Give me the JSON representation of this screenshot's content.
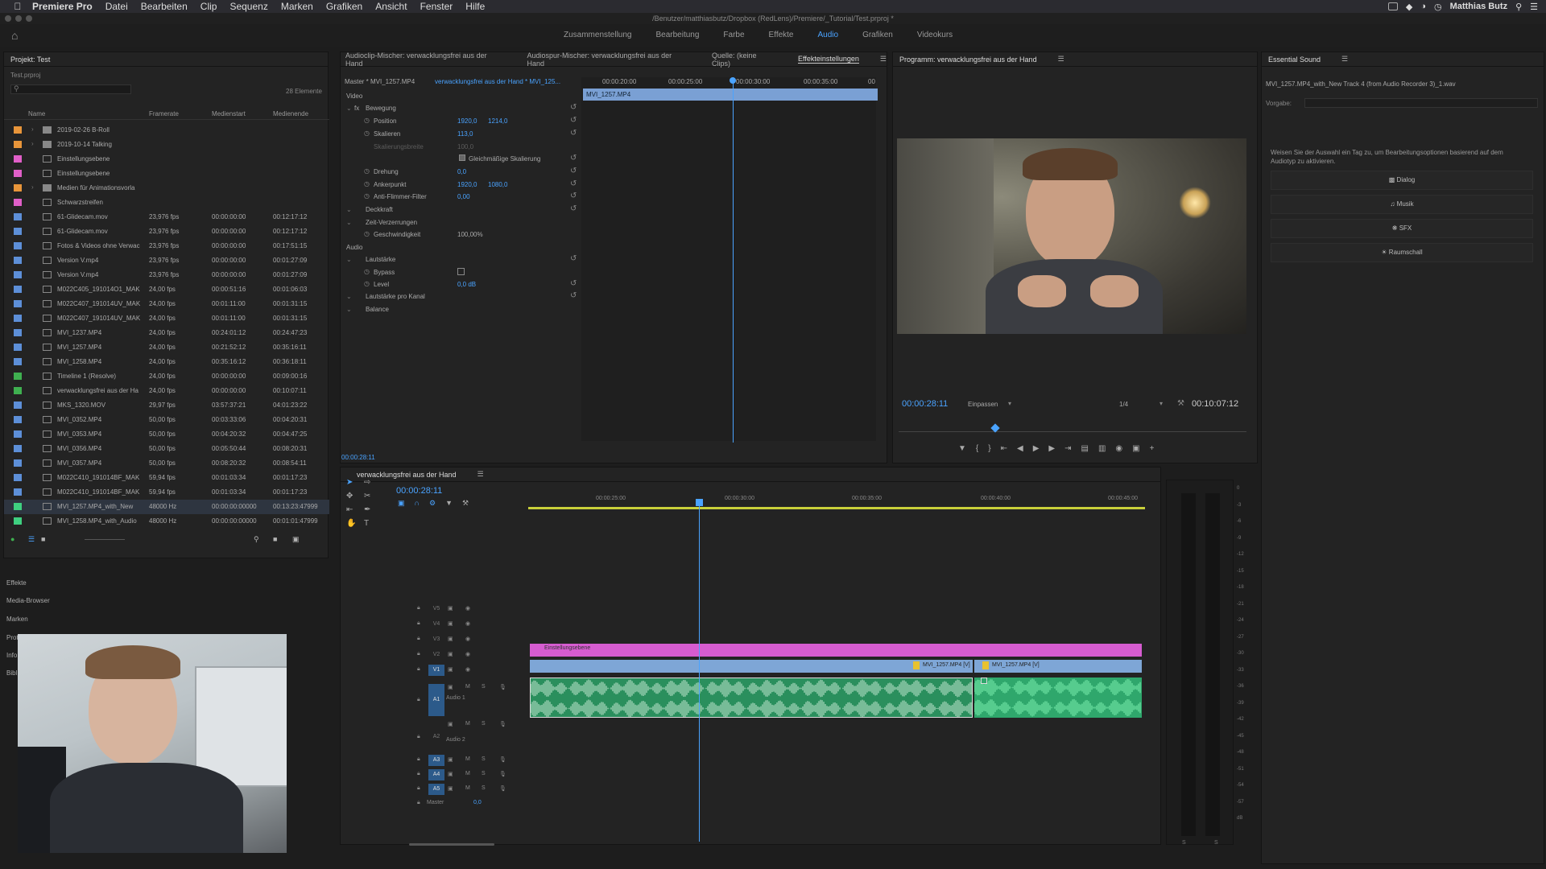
{
  "menubar": {
    "app": "Premiere Pro",
    "items": [
      "Datei",
      "Bearbeiten",
      "Clip",
      "Sequenz",
      "Marken",
      "Grafiken",
      "Ansicht",
      "Fenster",
      "Hilfe"
    ],
    "user": "Matthias Butz"
  },
  "titlebar": {
    "path": "/Benutzer/matthiasbutz/Dropbox (RedLens)/Premiere/_Tutorial/Test.prproj *"
  },
  "workspaces": {
    "tabs": [
      "Zusammenstellung",
      "Bearbeitung",
      "Farbe",
      "Effekte",
      "Audio",
      "Grafiken",
      "Videokurs"
    ],
    "active": "Audio"
  },
  "project": {
    "title": "Projekt: Test",
    "file": "Test.prproj",
    "count": "28 Elemente",
    "columns": {
      "name": "Name",
      "framerate": "Framerate",
      "start": "Medienstart",
      "end": "Medienende"
    },
    "rows": [
      {
        "color": "#e8953a",
        "name": "2019-02-26 B-Roll",
        "fr": "",
        "st": "",
        "en": "",
        "folder": true
      },
      {
        "color": "#e8953a",
        "name": "2019-10-14 Talking",
        "fr": "",
        "st": "",
        "en": "",
        "folder": true
      },
      {
        "color": "#e05fc8",
        "name": "Einstellungsebene",
        "fr": "",
        "st": "",
        "en": ""
      },
      {
        "color": "#e05fc8",
        "name": "Einstellungsebene",
        "fr": "",
        "st": "",
        "en": ""
      },
      {
        "color": "#e8953a",
        "name": "Medien für Animationsvorla",
        "fr": "",
        "st": "",
        "en": "",
        "folder": true
      },
      {
        "color": "#e05fc8",
        "name": "Schwarzstreifen",
        "fr": "",
        "st": "",
        "en": ""
      },
      {
        "color": "#5d8fd8",
        "name": "61-Glidecam.mov",
        "fr": "23,976 fps",
        "st": "00:00:00:00",
        "en": "00:12:17:12"
      },
      {
        "color": "#5d8fd8",
        "name": "61-Glidecam.mov",
        "fr": "23,976 fps",
        "st": "00:00:00:00",
        "en": "00:12:17:12"
      },
      {
        "color": "#5d8fd8",
        "name": "Fotos & Videos ohne Verwac",
        "fr": "23,976 fps",
        "st": "00:00:00:00",
        "en": "00:17:51:15"
      },
      {
        "color": "#5d8fd8",
        "name": "Version V.mp4",
        "fr": "23,976 fps",
        "st": "00:00:00:00",
        "en": "00:01:27:09"
      },
      {
        "color": "#5d8fd8",
        "name": "Version V.mp4",
        "fr": "23,976 fps",
        "st": "00:00:00:00",
        "en": "00:01:27:09"
      },
      {
        "color": "#5d8fd8",
        "name": "M022C405_191014O1_MAK",
        "fr": "24,00 fps",
        "st": "00:00:51:16",
        "en": "00:01:06:03"
      },
      {
        "color": "#5d8fd8",
        "name": "M022C407_191014UV_MAK",
        "fr": "24,00 fps",
        "st": "00:01:11:00",
        "en": "00:01:31:15"
      },
      {
        "color": "#5d8fd8",
        "name": "M022C407_191014UV_MAK",
        "fr": "24,00 fps",
        "st": "00:01:11:00",
        "en": "00:01:31:15"
      },
      {
        "color": "#5d8fd8",
        "name": "MVI_1237.MP4",
        "fr": "24,00 fps",
        "st": "00:24:01:12",
        "en": "00:24:47:23"
      },
      {
        "color": "#5d8fd8",
        "name": "MVI_1257.MP4",
        "fr": "24,00 fps",
        "st": "00:21:52:12",
        "en": "00:35:16:11"
      },
      {
        "color": "#5d8fd8",
        "name": "MVI_1258.MP4",
        "fr": "24,00 fps",
        "st": "00:35:16:12",
        "en": "00:36:18:11"
      },
      {
        "color": "#3fb050",
        "name": "Timeline 1 (Resolve)",
        "fr": "24,00 fps",
        "st": "00:00:00:00",
        "en": "00:09:00:16"
      },
      {
        "color": "#3fb050",
        "name": "verwacklungsfrei aus der Ha",
        "fr": "24,00 fps",
        "st": "00:00:00:00",
        "en": "00:10:07:11"
      },
      {
        "color": "#5d8fd8",
        "name": "MKS_1320.MOV",
        "fr": "29,97 fps",
        "st": "03:57:37:21",
        "en": "04:01:23:22"
      },
      {
        "color": "#5d8fd8",
        "name": "MVI_0352.MP4",
        "fr": "50,00 fps",
        "st": "00:03:33:06",
        "en": "00:04:20:31"
      },
      {
        "color": "#5d8fd8",
        "name": "MVI_0353.MP4",
        "fr": "50,00 fps",
        "st": "00:04:20:32",
        "en": "00:04:47:25"
      },
      {
        "color": "#5d8fd8",
        "name": "MVI_0356.MP4",
        "fr": "50,00 fps",
        "st": "00:05:50:44",
        "en": "00:08:20:31"
      },
      {
        "color": "#5d8fd8",
        "name": "MVI_0357.MP4",
        "fr": "50,00 fps",
        "st": "00:08:20:32",
        "en": "00:08:54:11"
      },
      {
        "color": "#5d8fd8",
        "name": "M022C410_191014BF_MAK",
        "fr": "59,94 fps",
        "st": "00:01:03:34",
        "en": "00:01:17:23"
      },
      {
        "color": "#5d8fd8",
        "name": "M022C410_191014BF_MAK",
        "fr": "59,94 fps",
        "st": "00:01:03:34",
        "en": "00:01:17:23"
      },
      {
        "color": "#3fd080",
        "name": "MVI_1257.MP4_with_New",
        "fr": "48000  Hz",
        "st": "00:00:00:00000",
        "en": "00:13:23:47999"
      },
      {
        "color": "#3fd080",
        "name": "MVI_1258.MP4_with_Audio",
        "fr": "48000  Hz",
        "st": "00:00:00:00000",
        "en": "00:01:01:47999"
      }
    ],
    "lower_tabs": [
      "Effekte",
      "Media-Browser",
      "Marken",
      "Protok",
      "Info",
      "Bibl"
    ]
  },
  "effects_panel": {
    "tabs": [
      "Audioclip-Mischer: verwacklungsfrei aus der Hand",
      "Audiospur-Mischer: verwacklungsfrei aus der Hand",
      "Quelle: (keine Clips)",
      "Effekteinstellungen"
    ],
    "active_tab": "Effekteinstellungen",
    "master": "Master * MVI_1257.MP4",
    "seq": "verwacklungsfrei aus der Hand * MVI_125...",
    "ruler": [
      "00:00:20:00",
      "00:00:25:00",
      "00:00:30:00",
      "00:00:35:00",
      "00"
    ],
    "clip": "MVI_1257.MP4",
    "section_video": "Video",
    "bewegung": "Bewegung",
    "position": "Position",
    "pos_x": "1920,0",
    "pos_y": "1214,0",
    "skalieren": "Skalieren",
    "skal_val": "113,0",
    "skal_breite": "Skalierungsbreite",
    "skal_breite_val": "100,0",
    "gleich": "Gleichmäßige Skalierung",
    "drehung": "Drehung",
    "drehung_val": "0,0",
    "anker": "Ankerpunkt",
    "anker_x": "1920,0",
    "anker_y": "1080,0",
    "flimmer": "Anti-Flimmer-Filter",
    "flimmer_val": "0,00",
    "deckkraft": "Deckkraft",
    "zeit": "Zeit-Verzerrungen",
    "geschw": "Geschwindigkeit",
    "geschw_val": "100,00%",
    "section_audio": "Audio",
    "lautstaerke": "Lautstärke",
    "bypass": "Bypass",
    "level": "Level",
    "level_val": "0,0 dB",
    "kanal": "Lautstärke pro Kanal",
    "balance": "Balance",
    "timecode": "00:00:28:11"
  },
  "program": {
    "title": "Programm: verwacklungsfrei aus der Hand",
    "timecode": "00:00:28:11",
    "fit": "Einpassen",
    "quality": "1/4",
    "duration": "00:10:07:12"
  },
  "essential_sound": {
    "title": "Essential Sound",
    "file": "MVI_1257.MP4_with_New Track 4 (from Audio Recorder 3)_1.wav",
    "preset_label": "Vorgabe:",
    "hint": "Weisen Sie der Auswahl ein Tag zu, um Bearbeitungsoptionen basierend auf dem Audiotyp zu aktivieren.",
    "buttons": [
      "Dialog",
      "Musik",
      "SFX",
      "Raumschall"
    ]
  },
  "timeline": {
    "title": "verwacklungsfrei aus der Hand",
    "timecode": "00:00:28:11",
    "ruler": [
      "00:00:25:00",
      "00:00:30:00",
      "00:00:35:00",
      "00:00:40:00",
      "00:00:45:00"
    ],
    "video_tracks": [
      "V5",
      "V4",
      "V3",
      "V2",
      "V1"
    ],
    "audio_tracks": [
      "A1",
      "A2",
      "A3",
      "A4",
      "A5"
    ],
    "audio1": "Audio 1",
    "audio2": "Audio 2",
    "master": "Master",
    "master_val": "0,0",
    "adj_clip": "Einstellungsebene",
    "clip_a": "MVI_1257.MP4 [V]",
    "clip_b": "MVI_1257.MP4 [V]",
    "colors": {
      "adjustment": "#d65cd0",
      "video": "#7ea6d6",
      "audio": "#2fa76c",
      "playhead": "#4aa3ff"
    }
  },
  "meter": {
    "labels": [
      "0",
      "-3",
      "-6",
      "-9",
      "-12",
      "-15",
      "-18",
      "-21",
      "-24",
      "-27",
      "-30",
      "-33",
      "-36",
      "-39",
      "-42",
      "-45",
      "-48",
      "-51",
      "-54",
      "-57",
      "dB"
    ],
    "bottom": [
      "S",
      "S"
    ]
  }
}
